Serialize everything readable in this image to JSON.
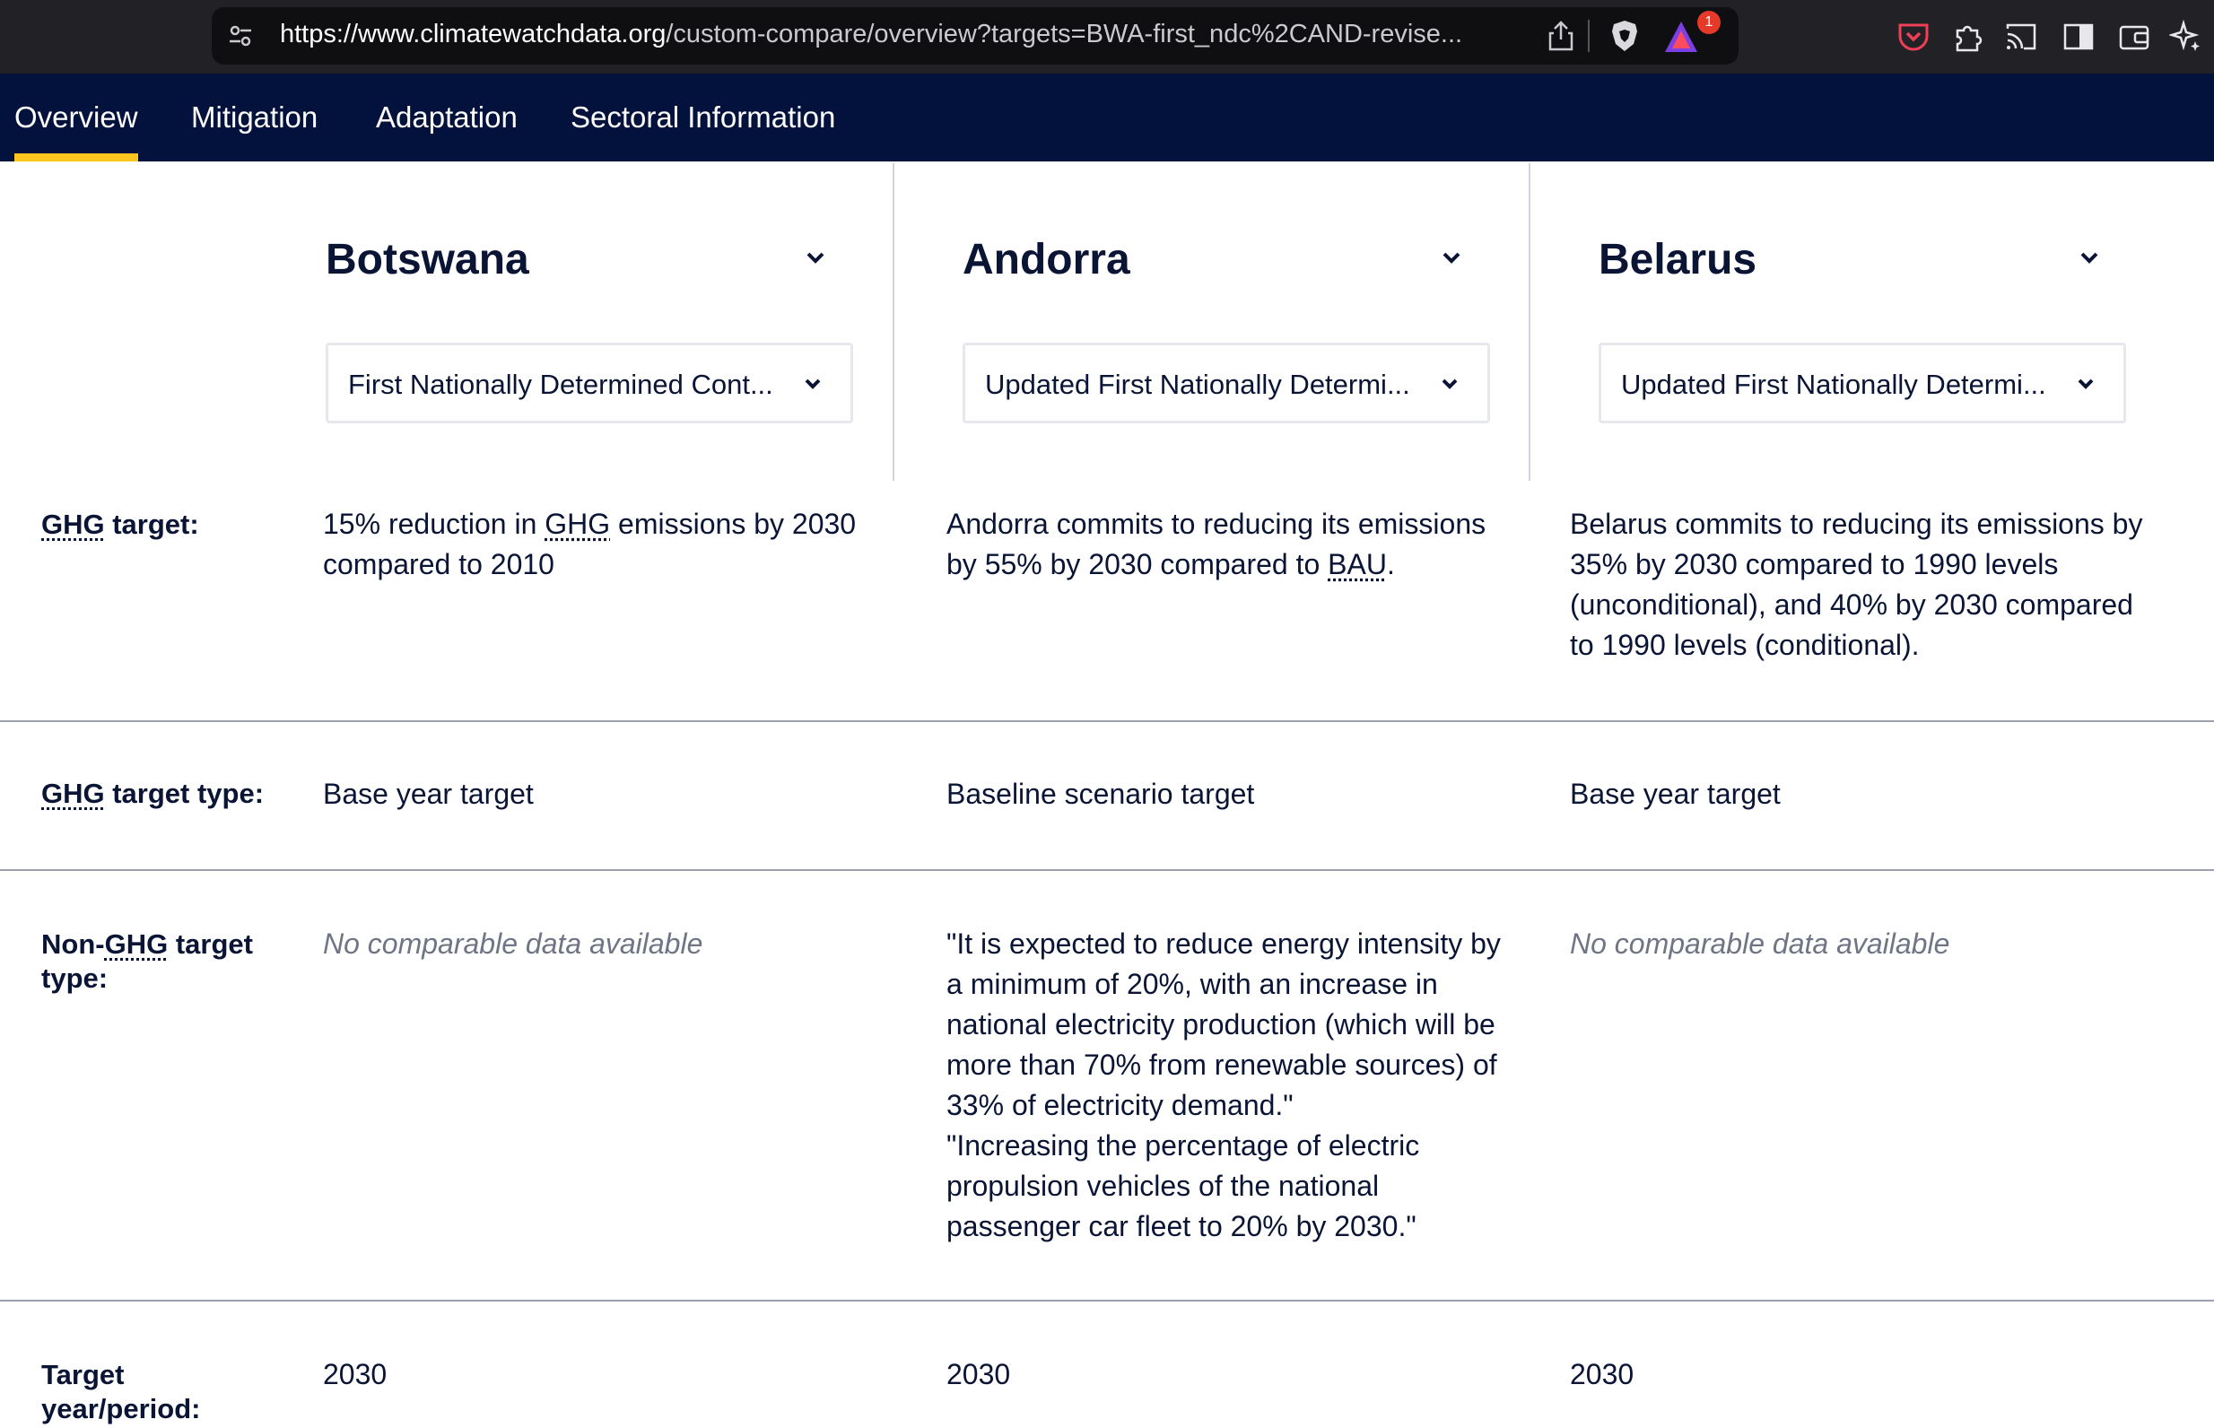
{
  "browser": {
    "url_host": "https://www.climatewatchdata.org",
    "url_path": "/custom-compare/overview?targets=BWA-first_ndc%2CAND-revise...",
    "rewards_badge": "1"
  },
  "nav": {
    "tabs": [
      {
        "label": "Overview",
        "active": true
      },
      {
        "label": "Mitigation",
        "active": false
      },
      {
        "label": "Adaptation",
        "active": false
      },
      {
        "label": "Sectoral Information",
        "active": false
      }
    ]
  },
  "columns": [
    {
      "country": "Botswana",
      "document": "First Nationally Determined Cont..."
    },
    {
      "country": "Andorra",
      "document": "Updated First Nationally Determi..."
    },
    {
      "country": "Belarus",
      "document": "Updated First Nationally Determi..."
    }
  ],
  "rows": {
    "ghg_target": {
      "label_abbr": "GHG",
      "label_rest": " target:",
      "botswana_pre": "15% reduction in ",
      "botswana_abbr": "GHG",
      "botswana_post": " emissions by 2030 compared to 2010",
      "andorra_pre": "Andorra commits to reducing its emissions by 55% by 2030 compared to ",
      "andorra_abbr": "BAU",
      "andorra_post": ".",
      "belarus": "Belarus commits to reducing its emissions by 35% by 2030 compared to 1990 levels (unconditional), and 40% by 2030 compared to 1990 levels (conditional)."
    },
    "ghg_target_type": {
      "label_abbr": "GHG",
      "label_rest": " target type:",
      "botswana": "Base year target",
      "andorra": "Baseline scenario target",
      "belarus": "Base year target"
    },
    "non_ghg_target_type": {
      "label_pre": "Non-",
      "label_abbr": "GHG",
      "label_rest": " target type:",
      "botswana": "No comparable data available",
      "andorra": "\"It is expected to reduce energy intensity by a minimum of 20%, with an increase in national electricity production (which will be more than 70% from renewable sources) of 33% of electricity demand.\"\n\"Increasing the percentage of electric propulsion vehicles of the national passenger car fleet to 20% by 2030.\"",
      "belarus": "No comparable data available"
    },
    "target_year": {
      "label": "Target year/period:",
      "botswana": "2030",
      "andorra": "2030",
      "belarus": "2030"
    }
  }
}
